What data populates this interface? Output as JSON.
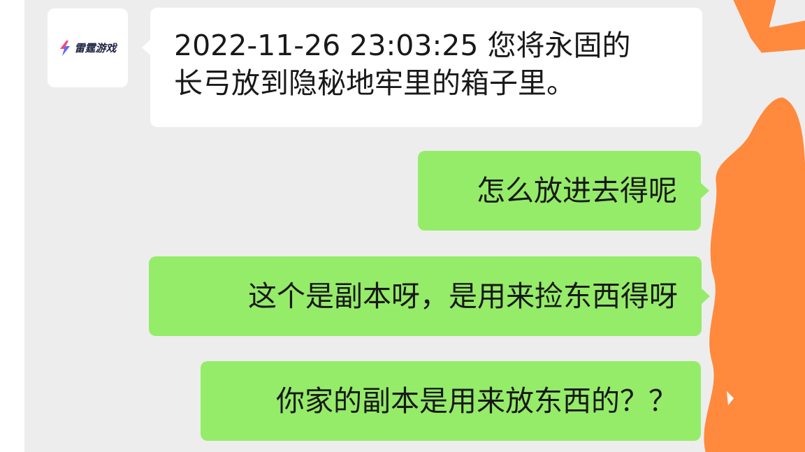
{
  "contact": {
    "avatar_logo_text": "雷霆游戏",
    "avatar_icon": "lightning-bolt-icon"
  },
  "messages": [
    {
      "sender": "contact",
      "lines": [
        "2022-11-26 23:03:25  您将永固的",
        "长弓放到隐秘地牢里的箱子里。"
      ]
    },
    {
      "sender": "self",
      "text": "怎么放进去得呢"
    },
    {
      "sender": "self",
      "text": "这个是副本呀，是用来捡东西得呀"
    },
    {
      "sender": "self",
      "text": "你家的副本是用来放东西的？？"
    }
  ],
  "colors": {
    "chat_background": "#ededed",
    "incoming_bubble": "#ffffff",
    "outgoing_bubble": "#95ec69",
    "redaction": "#ff8a3d"
  }
}
